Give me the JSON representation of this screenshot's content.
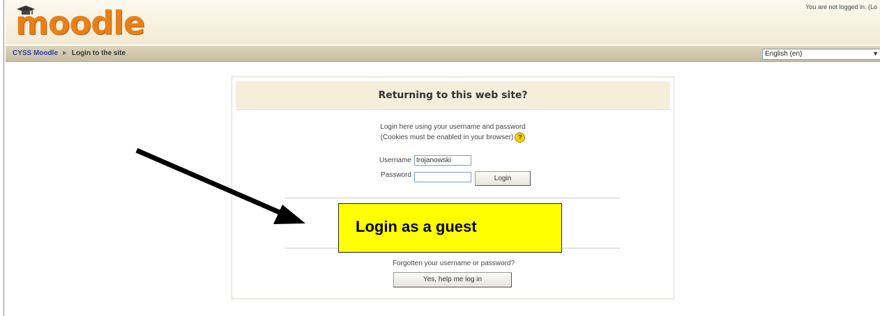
{
  "header": {
    "logo_text": "moodle",
    "login_info": "You are not logged in. (Lo"
  },
  "navbar": {
    "site_link": "CYSS Moodle",
    "separator": "►",
    "current": "Login to the site"
  },
  "language": {
    "selected": "English (en)"
  },
  "login_box": {
    "title": "Returning to this web site?",
    "intro_line1": "Login here using your username and password",
    "intro_line2": "(Cookies must be enabled in your browser)",
    "username_label": "Username",
    "username_value": "trojanowski",
    "password_label": "Password",
    "password_value": "",
    "login_button": "Login",
    "forgot_text": "Forgotten your username or password?",
    "help_button": "Yes, help me log in"
  },
  "callout": {
    "text": "Login as a guest",
    "color": "#ffff00"
  },
  "colors": {
    "logo": "#e8801a",
    "link": "#2a3fa8",
    "header_bg": "#f3ead3"
  }
}
